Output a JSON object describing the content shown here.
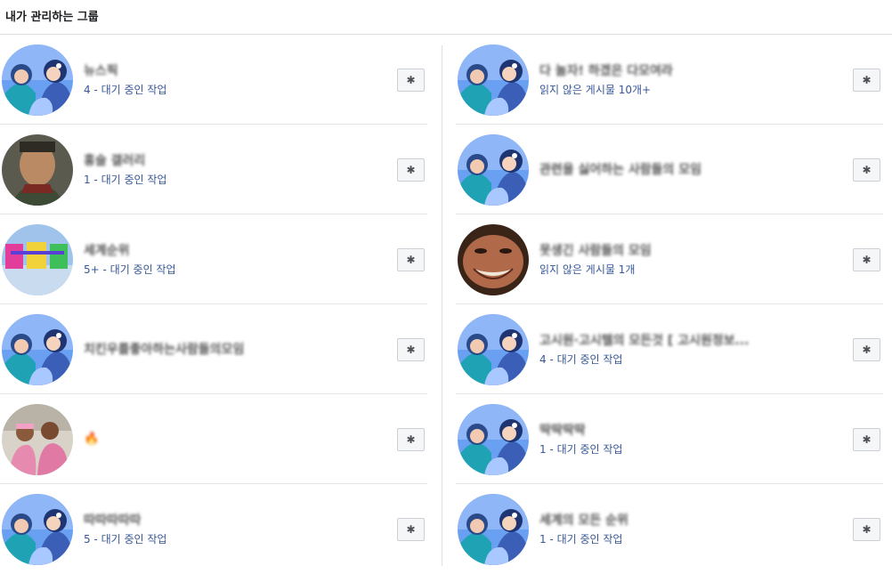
{
  "header": {
    "title": "내가 관리하는 그룹"
  },
  "icons": {
    "settings": "gear-icon"
  },
  "colors": {
    "link": "#385898",
    "divider": "#dddfe2",
    "button_bg": "#f5f6f7",
    "avatar_blue": "#5b8def",
    "avatar_teal": "#1fa3b4"
  },
  "groups_left": [
    {
      "name": "뉴스픽",
      "subtitle": "4 - 대기 중인 작업",
      "avatar": "default-illustration"
    },
    {
      "name": "홍술 갤러리",
      "subtitle": "1 - 대기 중인 작업",
      "avatar": "photo-man"
    },
    {
      "name": "세계순위",
      "subtitle": "5+ - 대기 중인 작업",
      "avatar": "rainbow-text"
    },
    {
      "name": "치킨우를좋아하는사람들의모임",
      "subtitle": "",
      "avatar": "default-illustration"
    },
    {
      "name": "🔥",
      "subtitle": "",
      "avatar": "photo-people"
    },
    {
      "name": "따따따따따",
      "subtitle": "5 - 대기 중인 작업",
      "avatar": "default-illustration"
    }
  ],
  "groups_right": [
    {
      "name": "다 놀자! 하겠은 다모여라",
      "subtitle": "읽지 않은 게시물 10개+",
      "avatar": "default-illustration"
    },
    {
      "name": "관련을 싫어하는 사람들의 모임",
      "subtitle": "",
      "avatar": "default-illustration"
    },
    {
      "name": "못생긴 사람들의 모임",
      "subtitle": "읽지 않은 게시물 1개",
      "avatar": "photo-face"
    },
    {
      "name": "고시원·고시텔의 모든것 [ 고시원정보...",
      "subtitle": "4 - 대기 중인 작업",
      "avatar": "default-illustration"
    },
    {
      "name": "딱딱딱딱",
      "subtitle": "1 - 대기 중인 작업",
      "avatar": "default-illustration"
    },
    {
      "name": "세계의 모든 순위",
      "subtitle": "1 - 대기 중인 작업",
      "avatar": "default-illustration"
    }
  ]
}
